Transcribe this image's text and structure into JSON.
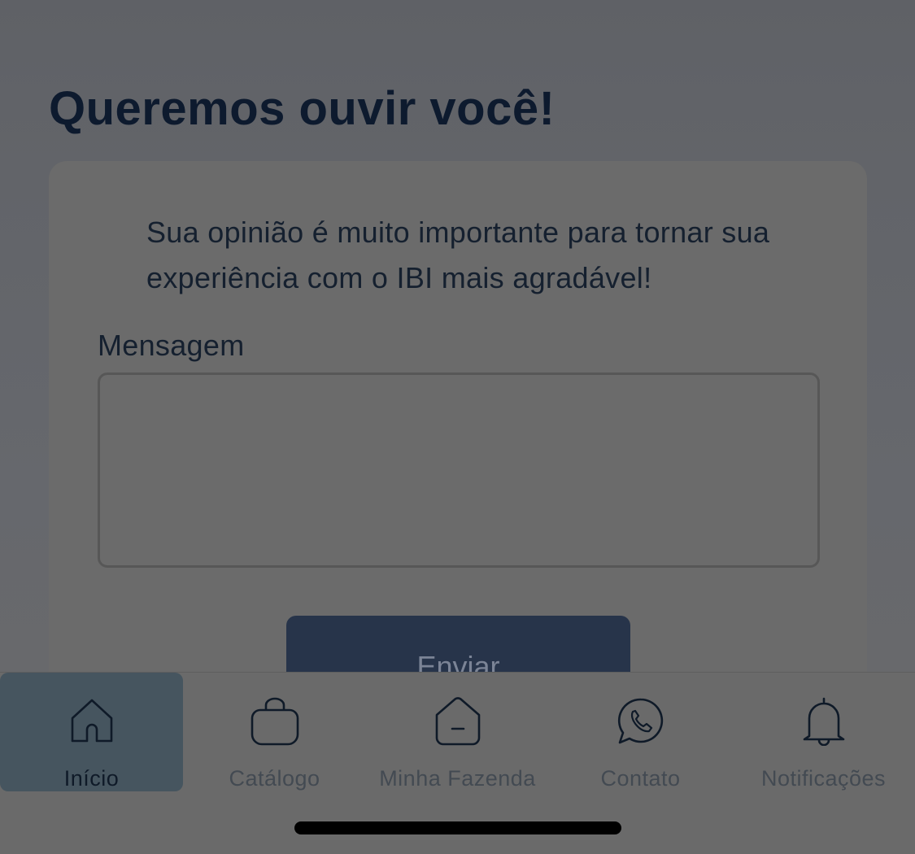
{
  "page": {
    "title": "Queremos ouvir você!"
  },
  "feedback": {
    "description": "Sua opinião é muito importante para tornar sua experiência com o IBI mais agradável!",
    "message_label": "Mensagem",
    "message_value": "",
    "send_label": "Enviar"
  },
  "tabbar": {
    "active_index": 0,
    "tabs": [
      {
        "label": "Início",
        "icon": "home-icon"
      },
      {
        "label": "Catálogo",
        "icon": "shopping-bag-icon"
      },
      {
        "label": "Minha Fazenda",
        "icon": "farm-house-icon"
      },
      {
        "label": "Contato",
        "icon": "whatsapp-icon"
      },
      {
        "label": "Notificações",
        "icon": "bell-icon"
      }
    ]
  },
  "colors": {
    "title": "#0d1a2e",
    "button_background": "#27344a",
    "active_tab_background": "#46555f"
  }
}
